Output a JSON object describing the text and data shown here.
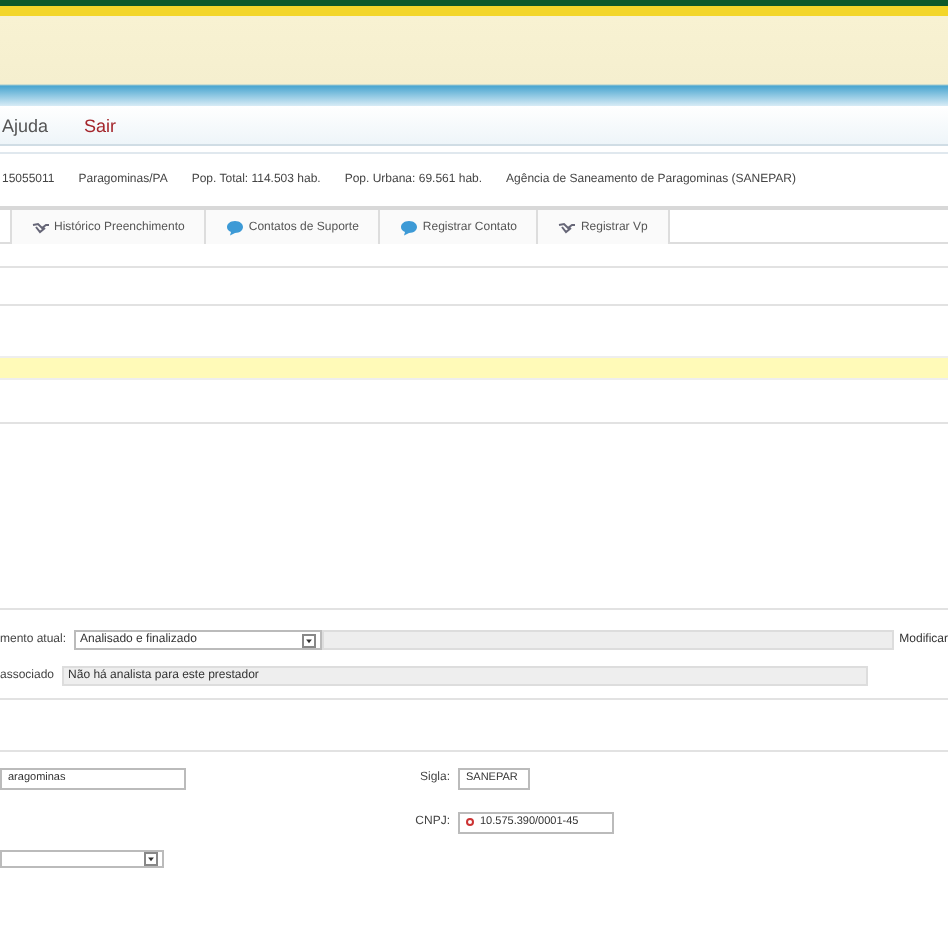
{
  "menu": [
    {
      "label": "Ajuda",
      "kind": "normal"
    },
    {
      "label": "Sair",
      "kind": "exit"
    }
  ],
  "info_bar": [
    "15055011",
    "Paragominas/PA",
    "Pop. Total: 114.503 hab.",
    "Pop. Urbana: 69.561 hab.",
    "Agência de Saneamento de Paragominas  (SANEPAR)"
  ],
  "toolbar": [
    {
      "label": "Histórico Preenchimento",
      "kind": "history"
    },
    {
      "label": "Contatos de Suporte",
      "kind": "contact"
    },
    {
      "label": "Registrar Contato",
      "kind": "contact"
    },
    {
      "label": "Registrar Vp",
      "kind": "history"
    }
  ],
  "status": {
    "current_label": "mento atual:",
    "current_value": "Analisado e finalizado",
    "action": "Modificar",
    "associated_label": "associado",
    "associated_value": "Não há analista para este prestador"
  },
  "provider": {
    "name_value": "aragominas",
    "sigla_label": "Sigla:",
    "sigla_value": "SANEPAR",
    "cnpj_label": "CNPJ:",
    "cnpj_value": "10.575.390/0001-45"
  }
}
